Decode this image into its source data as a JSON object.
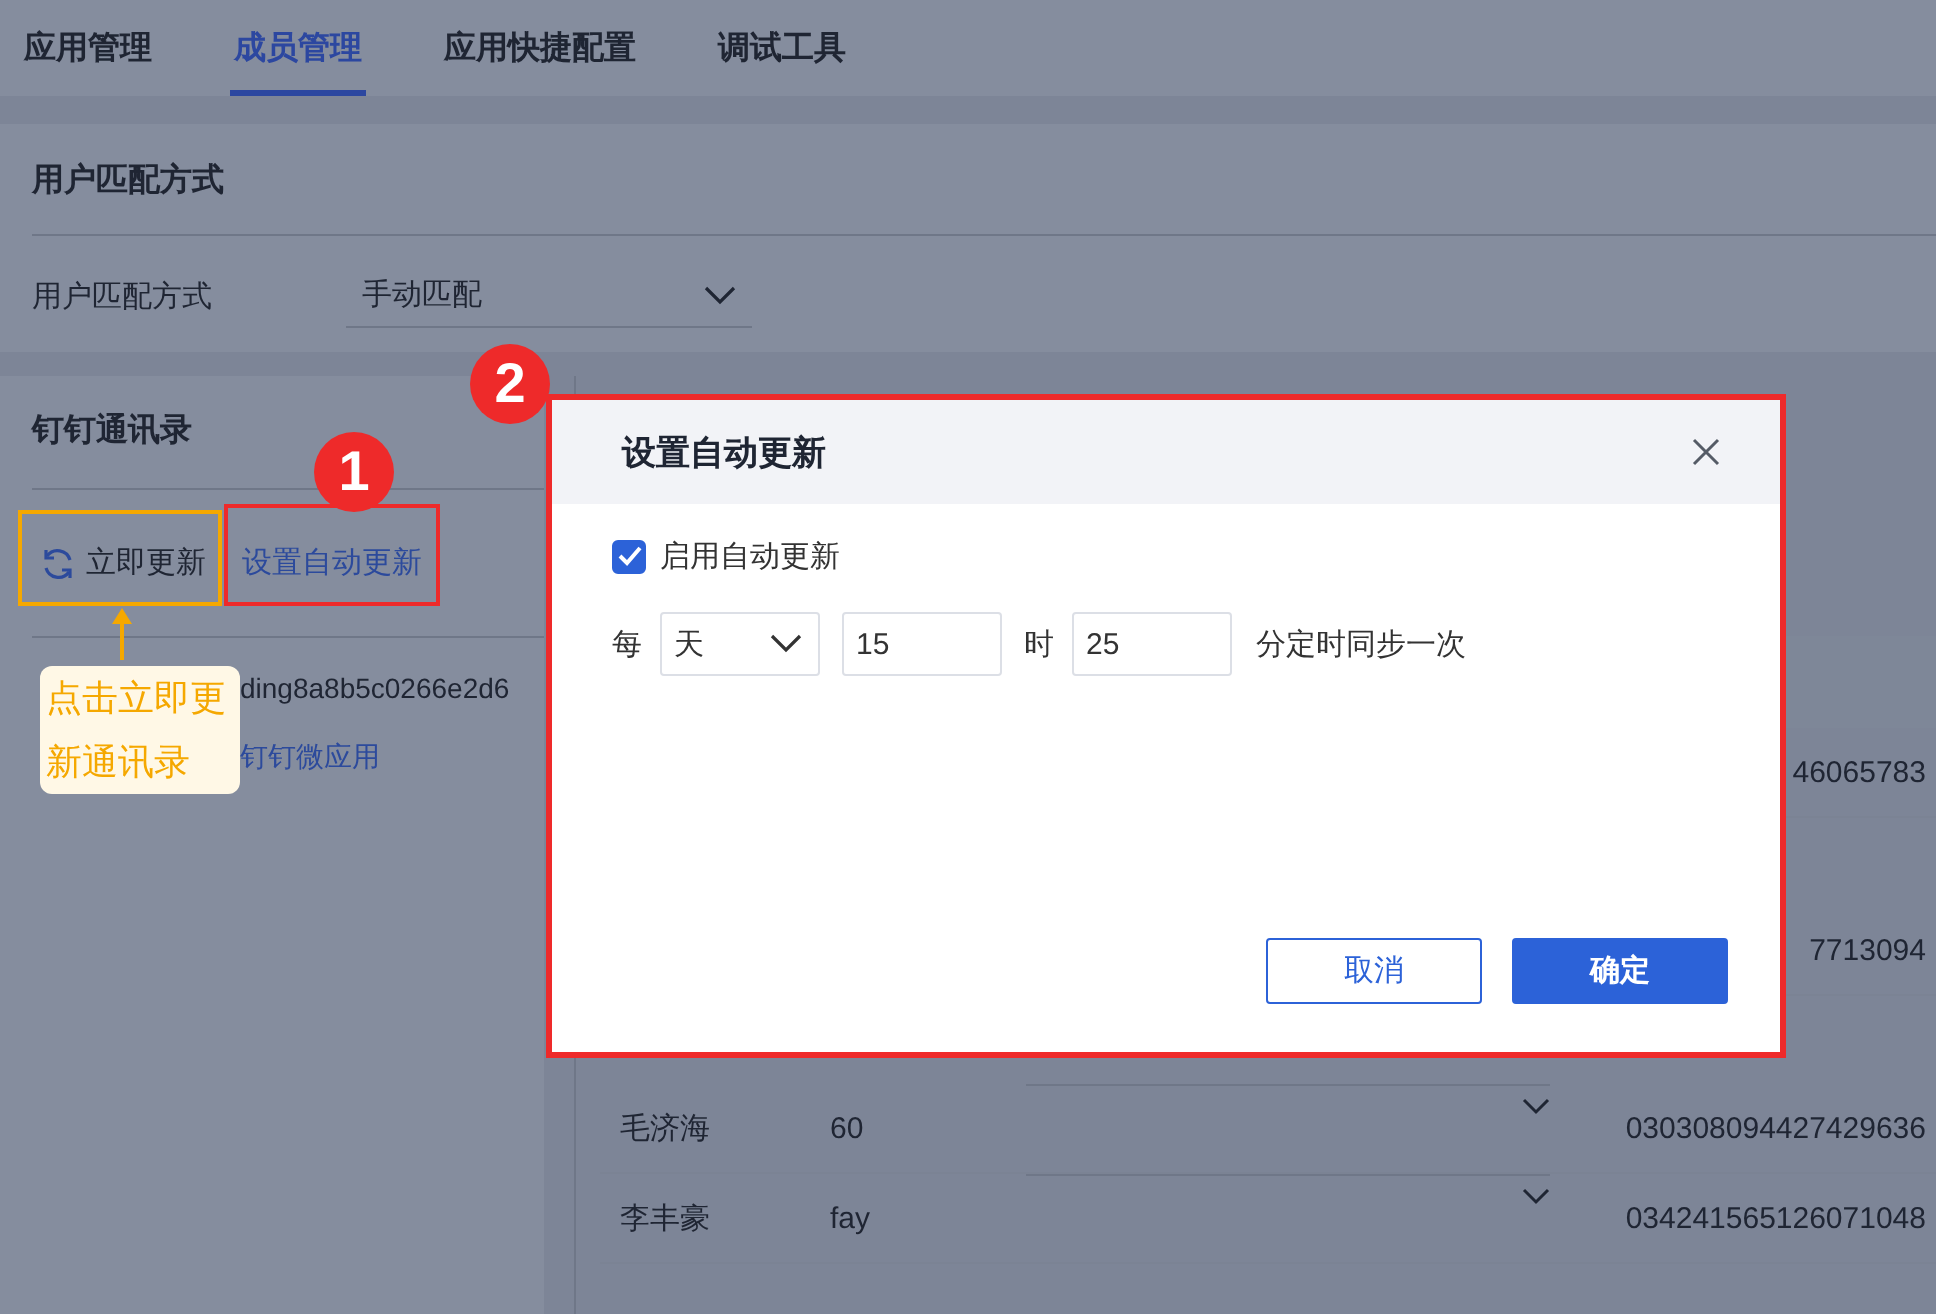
{
  "tabs": [
    {
      "label": "应用管理",
      "selected": false
    },
    {
      "label": "成员管理",
      "selected": true
    },
    {
      "label": "应用快捷配置",
      "selected": false
    },
    {
      "label": "调试工具",
      "selected": false
    }
  ],
  "match_section": {
    "title": "用户匹配方式",
    "field_label": "用户匹配方式",
    "select_value": "手动匹配"
  },
  "contacts_section": {
    "title": "钉钉通讯录",
    "refresh_button": "立即更新",
    "auto_update_link": "设置自动更新",
    "tree": [
      {
        "label": "ding8a8b5c0266e2d6"
      },
      {
        "label": "钉钉微应用"
      }
    ]
  },
  "table": {
    "rows": [
      {
        "column_4": "46065783"
      },
      {
        "column_4": "7713094"
      },
      {
        "column_1": "毛济海",
        "column_2": "60",
        "column_4": "030308094427429636"
      },
      {
        "column_1": "李丰豪",
        "column_2": "fay",
        "column_4": "034241565126071048"
      }
    ]
  },
  "dialog": {
    "title": "设置自动更新",
    "enable": {
      "label": "启用自动更新",
      "checked": true
    },
    "schedule": {
      "prefix": "每",
      "unit": "天",
      "hour": "15",
      "hour_label": "时",
      "minute": "25",
      "suffix": "分定时同步一次"
    },
    "buttons": [
      {
        "label": "取消",
        "kind": "secondary"
      },
      {
        "label": "确定",
        "kind": "primary"
      }
    ]
  },
  "annotations": {
    "badges": [
      "1",
      "2"
    ],
    "callout": "点击立即更新通讯录"
  }
}
